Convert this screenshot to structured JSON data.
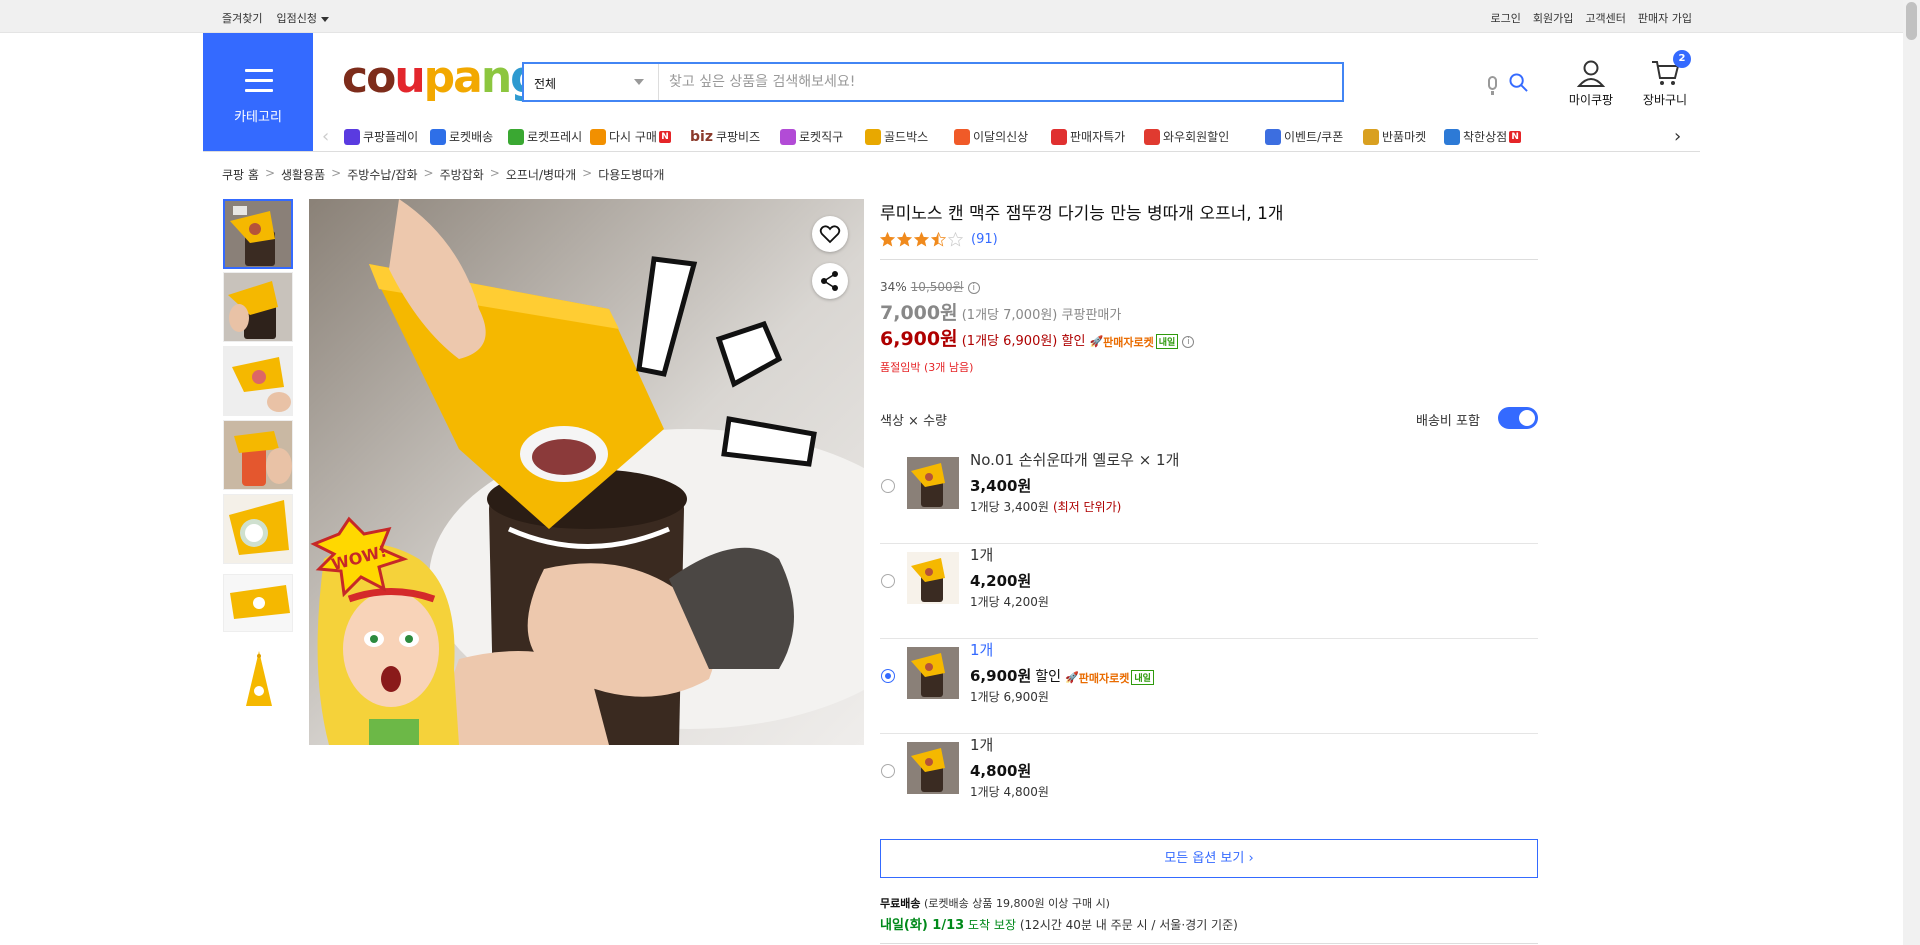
{
  "util": {
    "bookmark": "즐겨찾기",
    "seller_apply": "입점신청",
    "login": "로그인",
    "signup": "회원가입",
    "cs": "고객센터",
    "seller_signup": "판매자 가입"
  },
  "header": {
    "category_label": "카테고리",
    "logo": {
      "c1": "co",
      "c2": "u",
      "c3": "pa",
      "c4": "n",
      "c5": "g"
    },
    "search_category": "전체",
    "search_placeholder": "찾고 싶은 상품을 검색해보세요!",
    "mycoupang": "마이쿠팡",
    "cart": "장바구니",
    "cart_count": "2"
  },
  "nav": [
    {
      "label": "쿠팡플레이",
      "icon": "play-icon",
      "color": "#5a3be0"
    },
    {
      "label": "로켓배송",
      "icon": "rocket-icon",
      "color": "#2e6fe8"
    },
    {
      "label": "로켓프레시",
      "icon": "rocket-fresh-icon",
      "color": "#3aa832"
    },
    {
      "label": "다시 구매",
      "icon": "rebuy-icon",
      "color": "#f29000",
      "n": "N"
    },
    {
      "label": "쿠팡비즈",
      "icon": "biz-icon",
      "prefix": "biz",
      "color": "#8b3a2b"
    },
    {
      "label": "로켓직구",
      "icon": "global-icon",
      "color": "#b24bd6"
    },
    {
      "label": "골드박스",
      "icon": "goldbox-icon",
      "color": "#e8a800"
    },
    {
      "label": "이달의신상",
      "icon": "new-icon",
      "color": "#f05a28"
    },
    {
      "label": "판매자특가",
      "icon": "percent-icon",
      "color": "#e03030"
    },
    {
      "label": "와우회원할인",
      "icon": "wow-icon",
      "color": "#e03a30"
    },
    {
      "label": "이벤트/쿠폰",
      "icon": "event-icon",
      "color": "#3c6ee0"
    },
    {
      "label": "반품마켓",
      "icon": "return-market-icon",
      "color": "#d9a020"
    },
    {
      "label": "착한상점",
      "icon": "good-store-icon",
      "color": "#2d7ad6",
      "n": "N"
    }
  ],
  "breadcrumb": [
    "쿠팡 홈",
    "생활용품",
    "주방수납/잡화",
    "주방잡화",
    "오프너/병따개",
    "다용도병따개"
  ],
  "product": {
    "title": "루미노스 캔 맥주 잼뚜껑 다기능 만능 병따개 오프너, 1개",
    "rating": 3.5,
    "rating_count": "(91)",
    "discount_rate": "34%",
    "original_price": "10,500원",
    "price": "7,000원",
    "price_unit": "(1개당 7,000원)",
    "price_label": "쿠팡판매가",
    "sale_price": "6,900원",
    "sale_unit": "(1개당 6,900원)",
    "sale_label": "할인",
    "rocket_label": "판매자로켓",
    "rocket_day": "내일",
    "stock_note": "품절임박 (3개 남음)"
  },
  "options": {
    "header": "색상 × 수량",
    "ship_toggle_label": "배송비 포함",
    "ship_toggle_on": true,
    "items": [
      {
        "name": "No.01 손쉬운따개 옐로우 × 1개",
        "price": "3,400원",
        "unit": "1개당 3,400원",
        "low": "(최저 단위가)",
        "selected": false
      },
      {
        "name": "1개",
        "price": "4,200원",
        "unit": "1개당 4,200원",
        "selected": false
      },
      {
        "name": "1개",
        "price": "6,900원",
        "halin": "할인",
        "rocket": "판매자로켓",
        "rocket_day": "내일",
        "unit": "1개당 6,900원",
        "selected": true
      },
      {
        "name": "1개",
        "price": "4,800원",
        "unit": "1개당 4,800원",
        "selected": false
      }
    ],
    "all_options": "모든 옵션 보기 ›"
  },
  "shipping": {
    "free": "무료배송",
    "free_note": "(로켓배송 상품 19,800원 이상 구매 시)",
    "arrival_day": "내일(화) 1/13",
    "arrival_guarantee": "도착 보장",
    "arrival_note": "(12시간 40분 내 주문 시 / 서울·경기 기준)"
  }
}
